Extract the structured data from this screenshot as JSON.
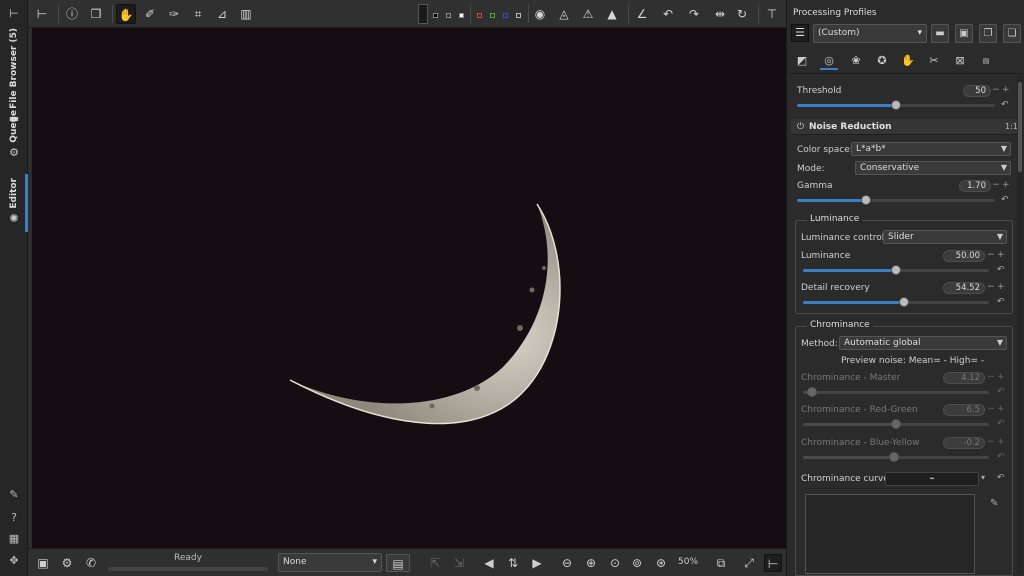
{
  "left_tabs": {
    "file_browser": "File Browser (5)",
    "queue": "Queue",
    "editor": "Editor"
  },
  "left_icons": [
    "folder-icon",
    "gears-icon",
    "camera-icon",
    "edit-icon",
    "help-icon",
    "grid-icon",
    "move-icon"
  ],
  "status": {
    "ready": "Ready",
    "preview_mode": "None",
    "zoom": "50%"
  },
  "profiles": {
    "label": "Processing Profiles",
    "current": "(Custom)"
  },
  "threshold": {
    "label": "Threshold",
    "value": "50",
    "level": 0.5
  },
  "noise_reduction": {
    "title": "Noise Reduction",
    "badge": "1:1",
    "color_space_label": "Color space:",
    "color_space_value": "L*a*b*",
    "mode_label": "Mode:",
    "mode_value": "Conservative",
    "gamma": {
      "label": "Gamma",
      "value": "1.70",
      "level": 0.35
    },
    "luminance": {
      "title": "Luminance",
      "control_label": "Luminance control:",
      "control_value": "Slider",
      "luminance": {
        "label": "Luminance",
        "value": "50.00",
        "level": 0.5
      },
      "detail_recovery": {
        "label": "Detail recovery",
        "value": "54.52",
        "level": 0.545
      }
    },
    "chrominance": {
      "title": "Chrominance",
      "method_label": "Method:",
      "method_value": "Automatic global",
      "preview_noise": "Preview noise: Mean= -   High= -",
      "master": {
        "label": "Chrominance - Master",
        "value": "4.12",
        "level": 0.05
      },
      "red_green": {
        "label": "Chrominance - Red-Green",
        "value": "6.5",
        "level": 0.5
      },
      "blue_yellow": {
        "label": "Chrominance - Blue-Yellow",
        "value": "-0.2",
        "level": 0.49
      },
      "curve_label": "Chrominance curve:"
    }
  },
  "colors": {
    "accent": "#3b7fc4",
    "viewer_bg": "#160d12",
    "panel_bg": "#2b2b2b"
  }
}
